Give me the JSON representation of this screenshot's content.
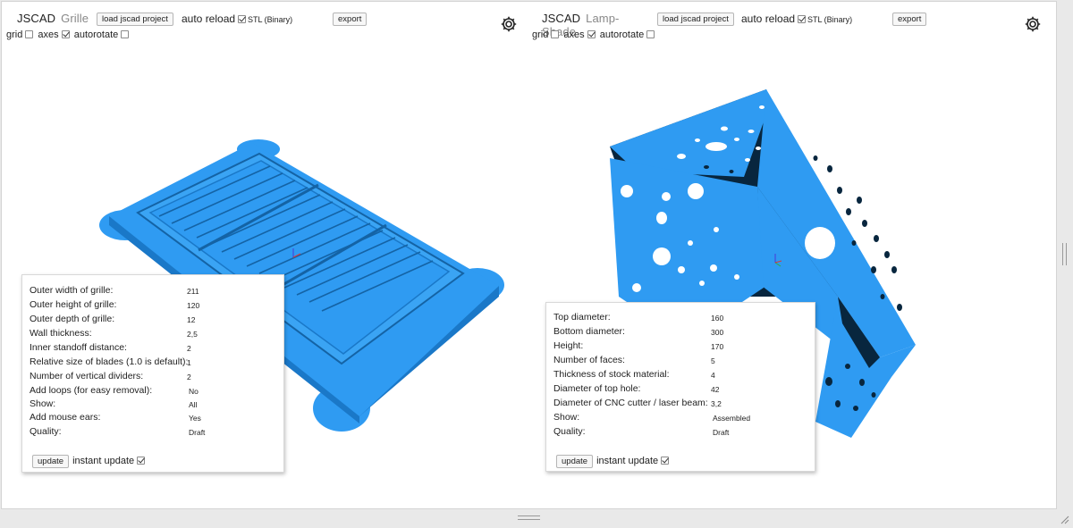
{
  "left": {
    "brand": "JSCAD",
    "title": "Grille",
    "load_label": "load jscad project",
    "auto_reload_label": "auto reload",
    "auto_reload_checked": true,
    "format": "STL (Binary)",
    "export_label": "export",
    "options": [
      {
        "label": "grid",
        "checked": false
      },
      {
        "label": "axes",
        "checked": true
      },
      {
        "label": "autorotate",
        "checked": false
      }
    ],
    "params": [
      {
        "label": "Outer width of grille:",
        "value": "211"
      },
      {
        "label": "Outer height of grille:",
        "value": "120"
      },
      {
        "label": "Outer depth of grille:",
        "value": "12"
      },
      {
        "label": "Wall thickness:",
        "value": "2,5"
      },
      {
        "label": "Inner standoff distance:",
        "value": "2"
      },
      {
        "label": "Relative size of blades (1.0 is default):",
        "value": "1"
      },
      {
        "label": "Number of vertical dividers:",
        "value": "2"
      },
      {
        "label": "Add loops (for easy removal):",
        "value": "No"
      },
      {
        "label": "Show:",
        "value": "All"
      },
      {
        "label": "Add mouse ears:",
        "value": "Yes"
      },
      {
        "label": "Quality:",
        "value": "Draft"
      }
    ],
    "update_label": "update",
    "instant_update_label": "instant update",
    "instant_update_checked": true
  },
  "right": {
    "brand": "JSCAD",
    "title": "Lamp-Shade",
    "load_label": "load jscad project",
    "auto_reload_label": "auto reload",
    "auto_reload_checked": true,
    "format": "STL (Binary)",
    "export_label": "export",
    "options": [
      {
        "label": "grid",
        "checked": false
      },
      {
        "label": "axes",
        "checked": true
      },
      {
        "label": "autorotate",
        "checked": false
      }
    ],
    "params": [
      {
        "label": "Top diameter:",
        "value": "160"
      },
      {
        "label": "Bottom diameter:",
        "value": "300"
      },
      {
        "label": "Height:",
        "value": "170"
      },
      {
        "label": "Number of faces:",
        "value": "5"
      },
      {
        "label": "Thickness of stock material:",
        "value": "4"
      },
      {
        "label": "Diameter of top hole:",
        "value": "42"
      },
      {
        "label": "Diameter of CNC cutter / laser beam:",
        "value": "3,2"
      },
      {
        "label": "Show:",
        "value": "Assembled"
      },
      {
        "label": "Quality:",
        "value": "Draft"
      }
    ],
    "update_label": "update",
    "instant_update_label": "instant update",
    "instant_update_checked": true
  },
  "colors": {
    "model": "#2f9bf2",
    "model_shadow": "#1463a5",
    "model_dark": "#08263e",
    "model_light": "#5fb6f7"
  },
  "icons": {
    "settings": "gear-icon",
    "splitter": "drag-handle-icon",
    "resize": "resize-corner-icon"
  }
}
